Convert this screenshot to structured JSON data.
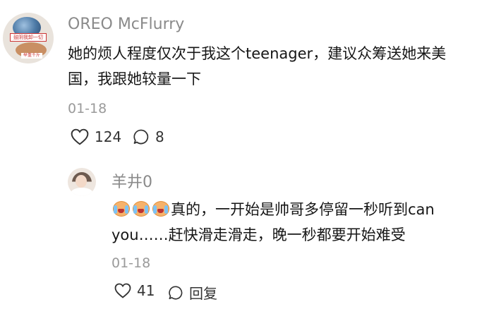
{
  "main_comment": {
    "username": "OREO McFlurry",
    "avatar_text_top": "鼓阴我卸一切",
    "avatar_text_bottom": "举重千斤",
    "text": "她的烦人程度仅次于我这个teenager，建议众筹送她来美国，我跟她较量一下",
    "date": "01-18",
    "like_count": "124",
    "comment_count": "8"
  },
  "reply": {
    "username": "羊井0",
    "emoji_icons": [
      "crying-face-icon",
      "crying-face-icon",
      "crying-face-icon"
    ],
    "text": "真的，一开始是帅哥多停留一秒听到can you……赶快滑走滑走，晚一秒都要开始难受",
    "date": "01-18",
    "like_count": "41",
    "reply_label": "回复"
  },
  "colors": {
    "text": "#161616",
    "secondary": "#8a8a8a",
    "date": "#9a9a9a"
  }
}
